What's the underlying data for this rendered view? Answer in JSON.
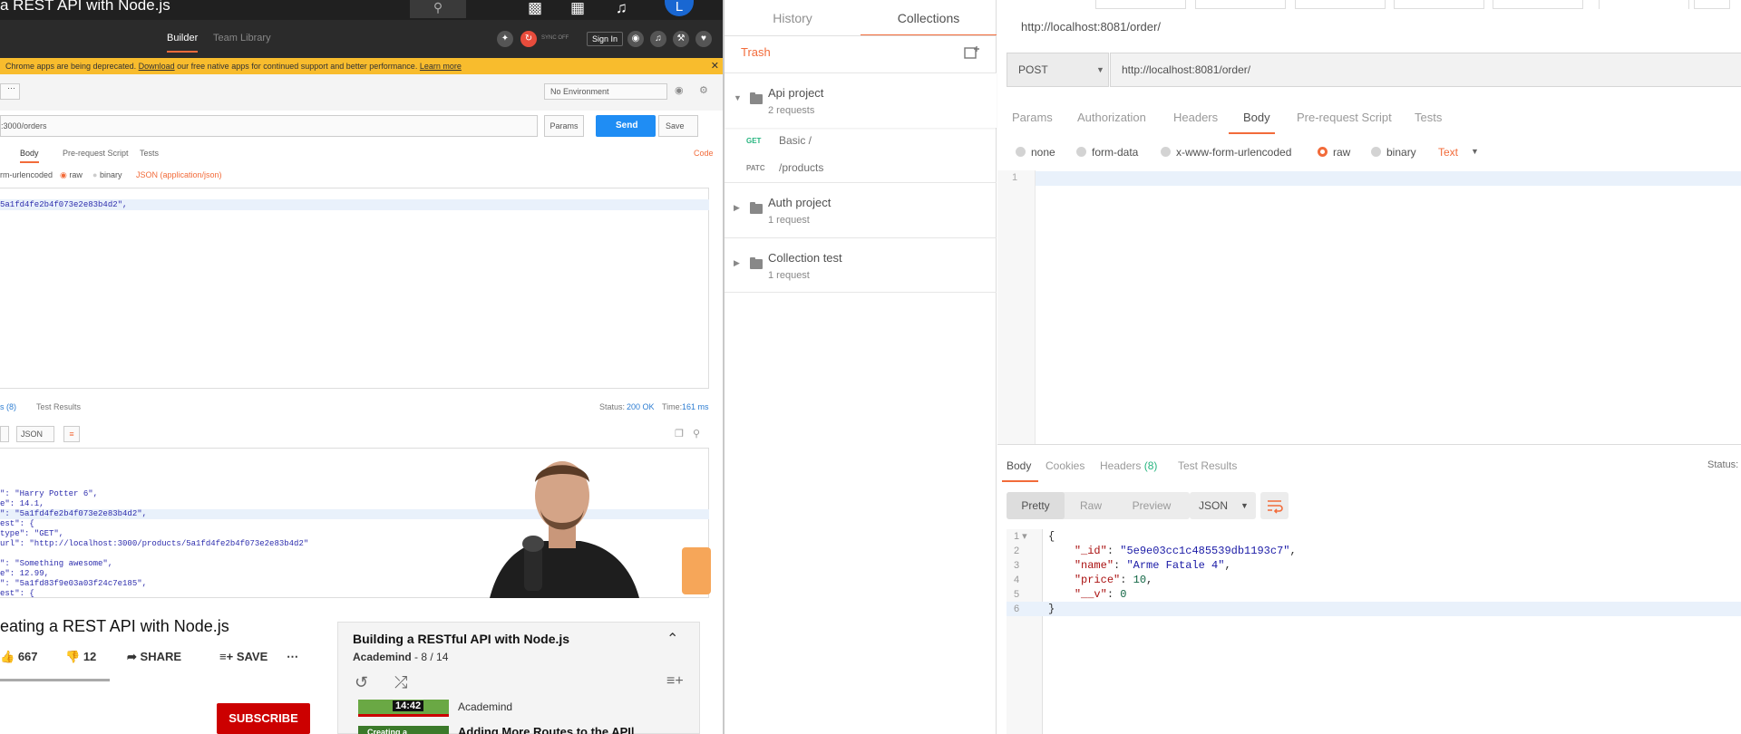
{
  "youtube": {
    "title": "a REST API with Node.js",
    "avatar_letter": "L",
    "video_title": "eating a REST API with Node.js",
    "likes": "667",
    "dislikes": "12",
    "share_label": "SHARE",
    "save_label": "SAVE",
    "subscribe_label": "SUBSCRIBE",
    "playlist": {
      "title": "Building a RESTful API with Node.js",
      "channel": "Academind",
      "position": " - 8 / 14",
      "item1_duration": "14:42",
      "item1_channel": "Academind",
      "item2_thumb_text": "Creating a",
      "item2_title": "Adding More Routes to the API|"
    }
  },
  "video_postman": {
    "tabs": [
      "Builder",
      "Team Library"
    ],
    "sync": "SYNC OFF",
    "signin": "Sign In",
    "banner_text": "Chrome apps are being deprecated.",
    "banner_download": "Download",
    "banner_rest": "our free native apps for continued support and better performance.",
    "banner_learn": "Learn more",
    "environment": "No Environment",
    "url": ":3000/orders",
    "params": "Params",
    "send": "Send",
    "save": "Save",
    "subtabs": [
      "Body",
      "Pre-request Script",
      "Tests"
    ],
    "code_link": "Code",
    "body_modes": [
      "rm-urlencoded",
      "raw",
      "binary"
    ],
    "body_format": "JSON (application/json)",
    "body_line": "5a1fd4fe2b4f073e2e83b4d2\",",
    "resp_tabs": [
      "s (8)",
      "Test Results"
    ],
    "status_label": "Status:",
    "status_value": "200 OK",
    "time_label": "Time:",
    "time_value": "161 ms",
    "resp_format": "JSON",
    "resp_lines": [
      "\": \"Harry Potter 6\",",
      "e\": 14.1,",
      "\": \"5a1fd4fe2b4f073e2e83b4d2\",",
      "est\": {",
      "type\": \"GET\",",
      "url\": \"http://localhost:3000/products/5a1fd4fe2b4f073e2e83b4d2\"",
      "",
      "",
      "",
      "\": \"Something awesome\",",
      "e\": 12.99,",
      "\": \"5a1fd83f9e03a03f24c7e185\",",
      "est\": {"
    ]
  },
  "sidebar": {
    "tabs": [
      "History",
      "Collections"
    ],
    "trash_label": "Trash",
    "folders": [
      {
        "name": "Api project",
        "count": "2 requests"
      },
      {
        "name": "Auth project",
        "count": "1 request"
      },
      {
        "name": "Collection test",
        "count": "1 request"
      }
    ],
    "requests": [
      {
        "method": "GET",
        "name": "Basic /",
        "color": "#26b47f"
      },
      {
        "method": "PATC",
        "name": "/products",
        "color": "#888888"
      }
    ]
  },
  "builder": {
    "request_name": "http://localhost:8081/order/",
    "method": "POST",
    "url": "http://localhost:8081/order/",
    "tabs": [
      "Params",
      "Authorization",
      "Headers",
      "Body",
      "Pre-request Script",
      "Tests"
    ],
    "body_modes": [
      "none",
      "form-data",
      "x-www-form-urlencoded",
      "raw",
      "binary"
    ],
    "selected_mode": "raw",
    "body_type": "Text",
    "line1": "1",
    "response": {
      "tabs": [
        "Body",
        "Cookies",
        "Headers",
        "Test Results"
      ],
      "headers_count": "(8)",
      "status_label": "Status:",
      "view_modes": [
        "Pretty",
        "Raw",
        "Preview"
      ],
      "format": "JSON",
      "json": {
        "_id": "5e9e03cc1c485539db1193c7",
        "name": "Arme Fatale 4",
        "price": "10",
        "__v": "0"
      }
    }
  },
  "colors": {
    "accent": "#f26b3a",
    "send": "#1f8df4",
    "subscribe": "#cc0000",
    "get": "#26b47f"
  }
}
